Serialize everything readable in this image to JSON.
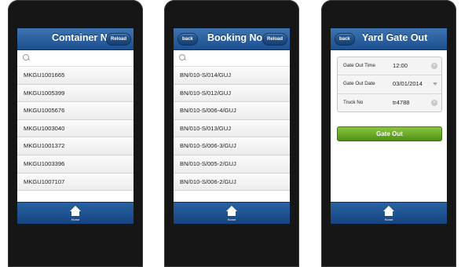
{
  "phone1": {
    "title": "Container No",
    "reload": "Reload",
    "items": [
      "MKGU1001665",
      "MKGU1005399",
      "MKGU1005676",
      "MKGU1003040",
      "MKGU1001372",
      "MKGU1003396",
      "MKGU1007107"
    ],
    "home": "Home"
  },
  "phone2": {
    "back": "back",
    "title": "Booking No",
    "reload": "Reload",
    "items": [
      "BN/010-S/014/GUJ",
      "BN/010-S/012/GUJ",
      "BN/010-S/006-4/GUJ",
      "BN/010-S/013/GUJ",
      "BN/010-S/006-3/GUJ",
      "BN/010-S/005-2/GUJ",
      "BN/010-S/006-2/GUJ"
    ],
    "home": "Home"
  },
  "phone3": {
    "back": "back",
    "title": "Yard Gate Out",
    "fields": [
      {
        "label": "Gate Out Time",
        "value": "12:00"
      },
      {
        "label": "Gate Out Date",
        "value": "03/01/2014"
      },
      {
        "label": "Truck No",
        "value": "tr4788"
      }
    ],
    "gate_out": "Gate Out",
    "home": "Home"
  },
  "colors": {
    "header_blue": "#1c4f8f",
    "button_green": "#6aaa28"
  }
}
